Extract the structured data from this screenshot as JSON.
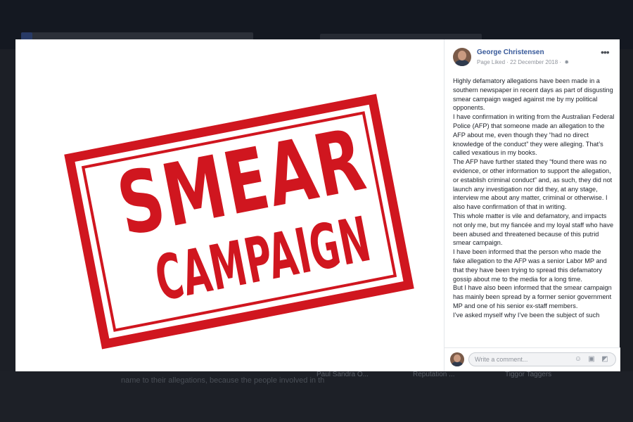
{
  "image": {
    "stamp_line1": "SMEAR",
    "stamp_line2": "CAMPAIGN"
  },
  "post": {
    "author": "George Christensen",
    "meta": "Page Liked · 22 December 2018 ·",
    "paragraphs": [
      "Highly defamatory allegations have been made in a southern newspaper in recent days as part of disgusting smear campaign waged against me by my political opponents.",
      "I have confirmation in writing from the Australian Federal Police (AFP) that someone made an allegation to the AFP about me, even though they “had no direct knowledge of the conduct” they were alleging. That’s called vexatious in my books.",
      "The AFP have further stated they “found there was no evidence, or other information to support the allegation, or establish criminal conduct” and, as such, they did not launch any investigation nor did they, at any stage, interview me about any matter, criminal or otherwise. I also have confirmation of that in writing.",
      "This whole matter is vile and defamatory, and impacts not only me, but my fiancée and my loyal staff who have been abused and threatened because of this putrid smear campaign.",
      "I have been informed that the person who made the fake allegation to the AFP was a senior Labor MP and that they have been trying to spread this defamatory gossip about me to the media for a long time.",
      "But I have also been informed that the smear campaign has mainly been spread by a former senior government MP and one of his senior ex-staff members.",
      "I’ve asked myself why I’ve been the subject of such"
    ]
  },
  "comment": {
    "placeholder": "Write a comment..."
  },
  "background": {
    "bottom_text": "name to their allegations, because the people involved in th",
    "chip1": "Paul Sandra O...",
    "chip2": "Reputation ...",
    "chip3": "Tiggor Taggers"
  },
  "colors": {
    "stamp_red": "#d0161f",
    "link_blue": "#365899"
  }
}
